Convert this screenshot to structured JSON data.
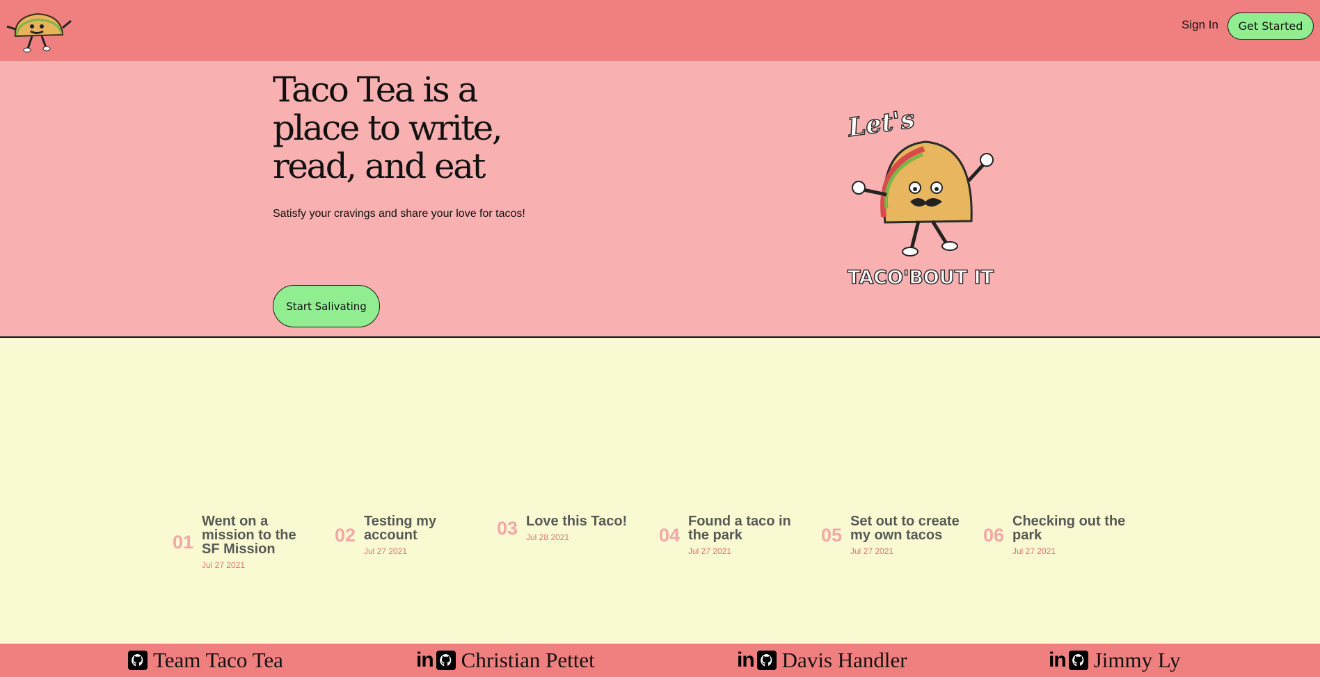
{
  "header": {
    "signin_label": "Sign In",
    "get_started_label": "Get Started"
  },
  "hero": {
    "title": "Taco Tea is a place to write, read, and eat",
    "subtitle": "Satisfy your cravings and share your love for tacos!",
    "cta_label": "Start Salivating",
    "art_text_top": "Let's",
    "art_text_bottom": "TACO'BOUT IT"
  },
  "posts": [
    {
      "num": "01",
      "title": "Went on a mission to the SF Mission",
      "date": "Jul 27 2021"
    },
    {
      "num": "02",
      "title": "Testing my account",
      "date": "Jul 27 2021"
    },
    {
      "num": "03",
      "title": "Love this Taco!",
      "date": "Jul 28 2021"
    },
    {
      "num": "04",
      "title": "Found a taco in the park",
      "date": "Jul 27 2021"
    },
    {
      "num": "05",
      "title": "Set out to create my own tacos",
      "date": "Jul 27 2021"
    },
    {
      "num": "06",
      "title": "Checking out the park",
      "date": "Jul 27 2021"
    }
  ],
  "footer": {
    "items": [
      {
        "name": "Team Taco Tea",
        "icons": [
          "github-icon"
        ]
      },
      {
        "name": "Christian Pettet",
        "icons": [
          "linkedin-icon",
          "github-icon"
        ]
      },
      {
        "name": "Davis Handler",
        "icons": [
          "linkedin-icon",
          "github-icon"
        ]
      },
      {
        "name": "Jimmy Ly",
        "icons": [
          "linkedin-icon",
          "github-icon"
        ]
      }
    ],
    "linkedin_glyph": "in"
  },
  "colors": {
    "header_bg": "#f08080",
    "hero_bg": "#f8b0b0",
    "page_bg": "#fafad2",
    "button_green": "#90ee90",
    "post_number": "#f4a7a7",
    "post_date": "#e07272"
  }
}
